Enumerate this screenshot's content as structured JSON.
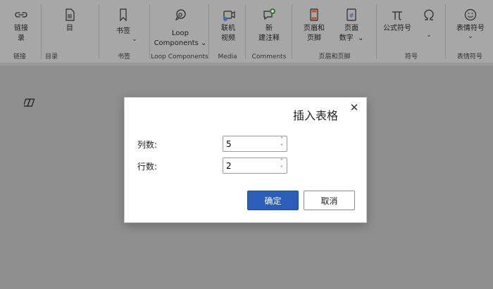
{
  "ribbon": {
    "groups": {
      "link": {
        "label": "链接",
        "btn": "链接\n录"
      },
      "toc": {
        "label": "目录",
        "btn": "目"
      },
      "bookmark": {
        "label": "书签",
        "btn": "书签"
      },
      "loop": {
        "label": "Loop Components",
        "btn_line1": "Loop",
        "btn_line2": "Components"
      },
      "media": {
        "label": "Media",
        "btn_line1": "联机",
        "btn_line2": "视频"
      },
      "comments": {
        "label": "Comments",
        "btn_line1": "新",
        "btn_line2": "建注释"
      },
      "header_footer": {
        "label": "页眉和页脚",
        "btn1_line1": "页眉和",
        "btn1_line2": "页脚",
        "btn2_line1": "页面",
        "btn2_line2": "数字"
      },
      "symbols": {
        "label": "符号",
        "btn1": "公式符号",
        "btn2": ""
      },
      "emoji": {
        "label": "表情符号",
        "btn": "表情符号"
      }
    }
  },
  "dialog": {
    "title": "插入表格",
    "columns_label": "列数:",
    "columns_value": "5",
    "rows_label": "行数:",
    "rows_value": "2",
    "ok_label": "确定",
    "cancel_label": "取消"
  },
  "colors": {
    "primary_button": "#2b5eb8",
    "overlay": "#8f8f8f"
  }
}
